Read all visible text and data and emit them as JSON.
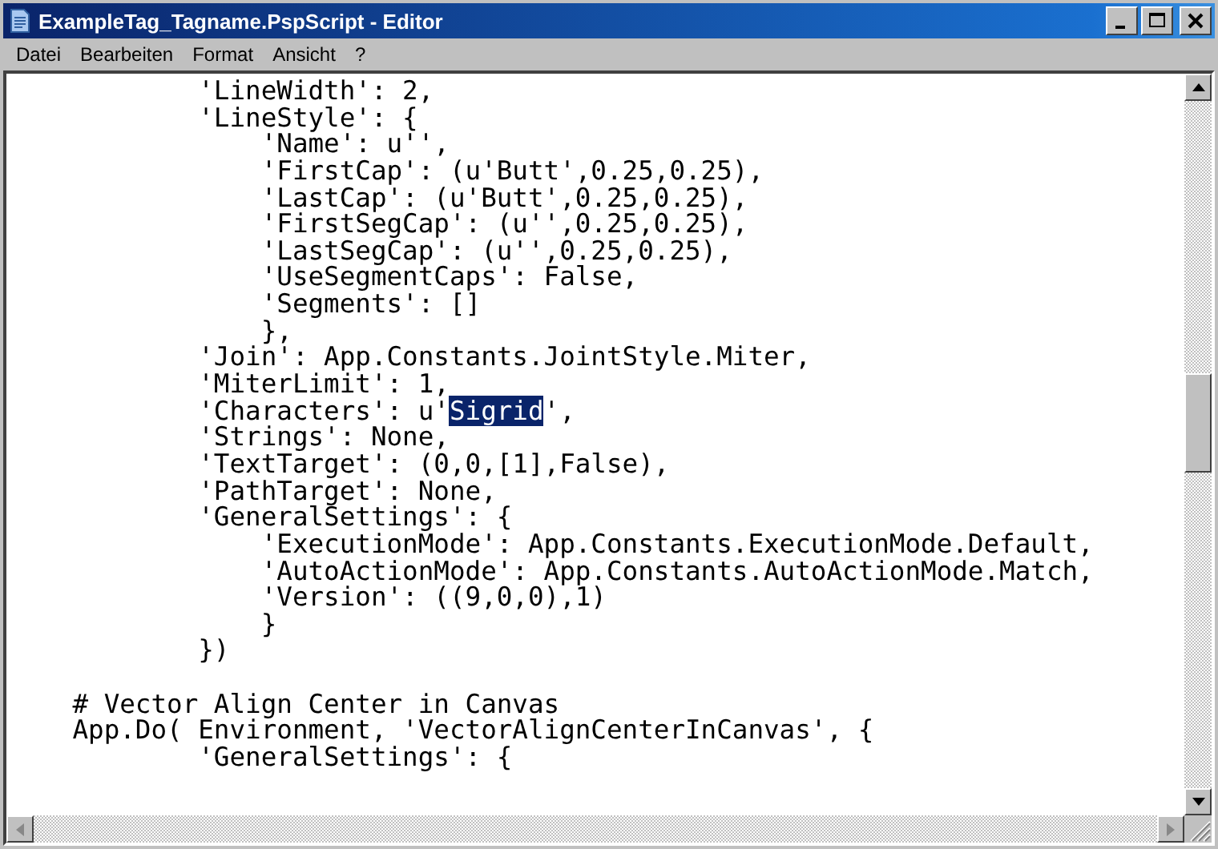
{
  "window": {
    "title": "ExampleTag_Tagname.PspScript - Editor"
  },
  "menu": [
    "Datei",
    "Bearbeiten",
    "Format",
    "Ansicht",
    "?"
  ],
  "lines": [
    {
      "kind": "code",
      "text": "            'LineWidth': 2,"
    },
    {
      "kind": "code",
      "text": "            'LineStyle': {"
    },
    {
      "kind": "code",
      "text": "                'Name': u'',"
    },
    {
      "kind": "code",
      "text": "                'FirstCap': (u'Butt',0.25,0.25),"
    },
    {
      "kind": "code",
      "text": "                'LastCap': (u'Butt',0.25,0.25),"
    },
    {
      "kind": "code",
      "text": "                'FirstSegCap': (u'',0.25,0.25),"
    },
    {
      "kind": "code",
      "text": "                'LastSegCap': (u'',0.25,0.25),"
    },
    {
      "kind": "code",
      "text": "                'UseSegmentCaps': False,"
    },
    {
      "kind": "code",
      "text": "                'Segments': []"
    },
    {
      "kind": "code",
      "text": "                },"
    },
    {
      "kind": "code",
      "text": "            'Join': App.Constants.JointStyle.Miter,"
    },
    {
      "kind": "code",
      "text": "            'MiterLimit': 1,"
    },
    {
      "kind": "parts",
      "parts": [
        {
          "text": "            'Characters': u'",
          "selected": false
        },
        {
          "text": "Sigrid",
          "selected": true
        },
        {
          "text": "',",
          "selected": false
        }
      ]
    },
    {
      "kind": "code",
      "text": "            'Strings': None,"
    },
    {
      "kind": "code",
      "text": "            'TextTarget': (0,0,[1],False),"
    },
    {
      "kind": "code",
      "text": "            'PathTarget': None,"
    },
    {
      "kind": "code",
      "text": "            'GeneralSettings': {"
    },
    {
      "kind": "code",
      "text": "                'ExecutionMode': App.Constants.ExecutionMode.Default,"
    },
    {
      "kind": "code",
      "text": "                'AutoActionMode': App.Constants.AutoActionMode.Match,"
    },
    {
      "kind": "code",
      "text": "                'Version': ((9,0,0),1)"
    },
    {
      "kind": "code",
      "text": "                }"
    },
    {
      "kind": "code",
      "text": "            })"
    },
    {
      "kind": "blank"
    },
    {
      "kind": "code",
      "text": "    # Vector Align Center in Canvas"
    },
    {
      "kind": "code",
      "text": "    App.Do( Environment, 'VectorAlignCenterInCanvas', {"
    },
    {
      "kind": "code",
      "text": "            'GeneralSettings': {"
    }
  ]
}
